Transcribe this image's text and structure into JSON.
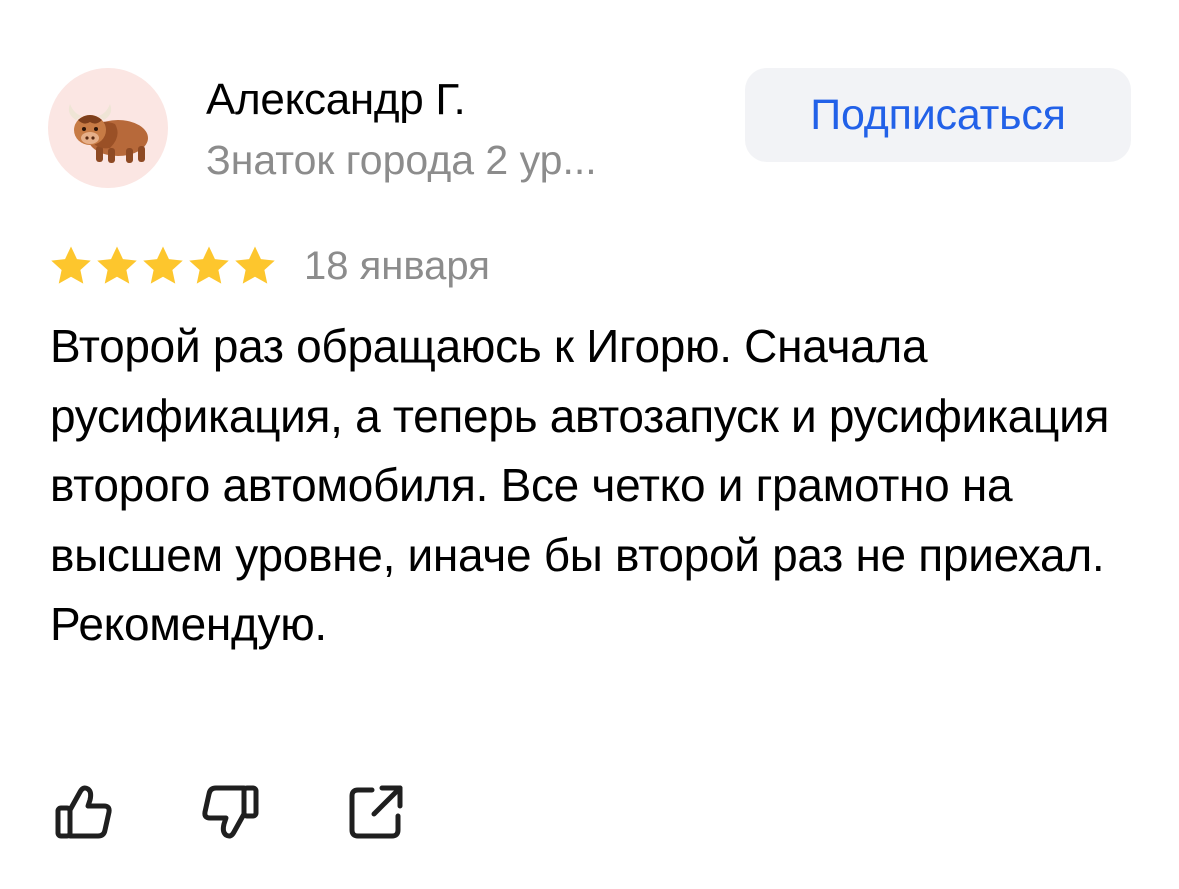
{
  "author": {
    "name": "Александр Г.",
    "level": "Знаток города 2 ур...",
    "avatar_icon": "yak-emoji-icon"
  },
  "subscribe": {
    "label": "Подписаться"
  },
  "review": {
    "rating": 5,
    "rating_max": 5,
    "date": "18 января",
    "text": "Второй раз обращаюсь к Игорю. Сначала русификация, а теперь автозапуск и русификация второго автомобиля. Все четко и грамотно на высшем уровне, иначе бы второй раз не приехал. Рекомендую."
  },
  "actions": {
    "like_icon": "thumbs-up-icon",
    "dislike_icon": "thumbs-down-icon",
    "share_icon": "share-icon"
  },
  "colors": {
    "accent": "#2261e8",
    "star": "#fdc62d",
    "secondary_text": "#8c8c8c",
    "button_bg": "#f2f3f6",
    "avatar_bg": "#fbe6e3"
  }
}
